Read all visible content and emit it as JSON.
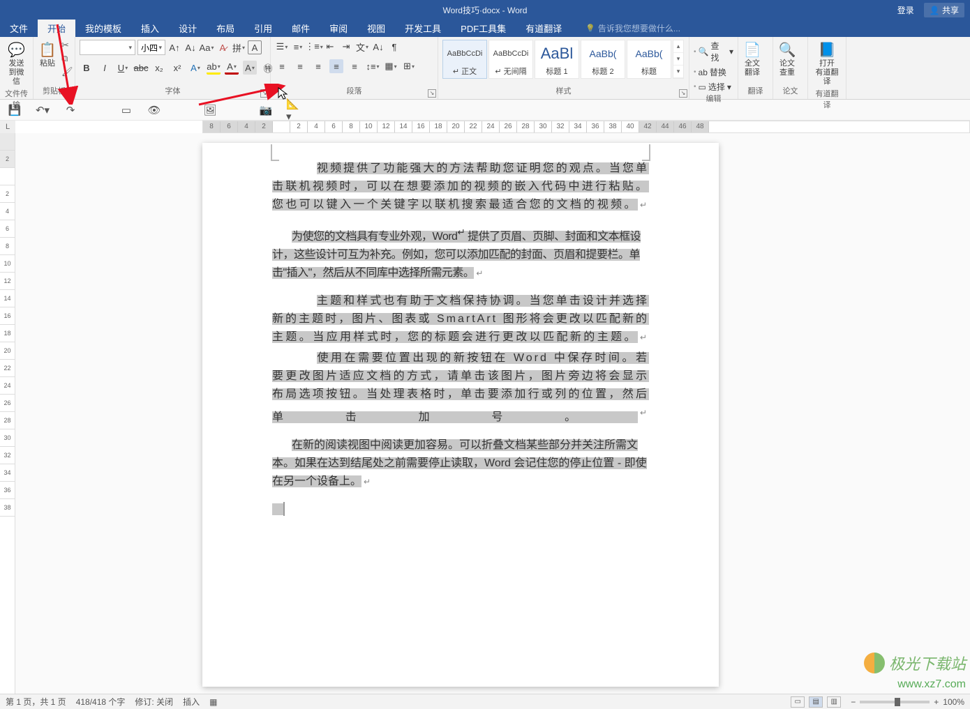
{
  "titlebar": {
    "title": "Word技巧·docx - Word",
    "login": "登录",
    "share": "共享"
  },
  "tabs": {
    "file": "文件",
    "home": "开始",
    "mytpl": "我的模板",
    "insert": "插入",
    "design": "设计",
    "layout": "布局",
    "ref": "引用",
    "mail": "邮件",
    "review": "审阅",
    "view": "视图",
    "dev": "开发工具",
    "pdf": "PDF工具集",
    "yd": "有道翻译",
    "tell": "告诉我您想要做什么..."
  },
  "groups": {
    "wechat": "文件传输",
    "clipboard": "剪贴板",
    "font": "字体",
    "para": "段落",
    "styles": "样式",
    "edit": "编辑",
    "trans": "翻译",
    "find": "论文",
    "yd": "有道翻译"
  },
  "wechat": {
    "line1": "发送",
    "line2": "到微信"
  },
  "clip": {
    "paste": "粘贴"
  },
  "font": {
    "name": "",
    "size": "小四"
  },
  "styles": {
    "s1": {
      "prev": "AaBbCcDi",
      "name": "↵ 正文"
    },
    "s2": {
      "prev": "AaBbCcDi",
      "name": "↵ 无间隔"
    },
    "s3": {
      "prev": "AaBl",
      "name": "标题 1"
    },
    "s4": {
      "prev": "AaBb(",
      "name": "标题 2"
    },
    "s5": {
      "prev": "AaBb(",
      "name": "标题"
    }
  },
  "edit": {
    "find": "查找",
    "replace": "替换",
    "select": "选择"
  },
  "trans": {
    "l1": "全文",
    "l2": "翻译"
  },
  "findg": {
    "l1": "论文",
    "l2": "查重"
  },
  "ydg": {
    "l1": "打开",
    "l2": "有道翻译"
  },
  "ruler_nums": [
    "8",
    "6",
    "4",
    "2",
    "",
    "2",
    "4",
    "6",
    "8",
    "10",
    "12",
    "14",
    "16",
    "18",
    "20",
    "22",
    "24",
    "26",
    "28",
    "30",
    "32",
    "34",
    "36",
    "38",
    "40",
    "42",
    "44",
    "46",
    "48"
  ],
  "vruler": [
    "",
    "2",
    "",
    "2",
    "4",
    "6",
    "8",
    "10",
    "12",
    "14",
    "16",
    "18",
    "20",
    "22",
    "24",
    "26",
    "28",
    "30",
    "32",
    "34",
    "36",
    "38"
  ],
  "doc": {
    "p1": "视频提供了功能强大的方法帮助您证明您的观点。当您单击联机视频时，可以在想要添加的视频的嵌入代码中进行粘贴。您也可以键入一个关键字以联机搜索最适合您的文档的视频。",
    "p2a": "为使您的文档具有专业外观，Word",
    "p2b": " 提供了页眉、页脚、封面和文本框设计，这些设计可互为补充。例如，您可以添加匹配的封面、页眉和提要栏。单击\"插入\"，然后从不同库中选择所需元素。",
    "p3a": "主题和样式也有助于文档保持协调。当您单击设计并选择新的主题时，图片、图表或 SmartArt 图形将会更改以匹配新的主题。当应用样式时，您的标题会进行更改以匹配新的主题。",
    "p3b": "使用在需要位置出现的新按钮在 Word 中保存时间。若要更改图片适应文档的方式，请单击该图片，图片旁边将会显示布局选项按钮。当处理表格时，单击要添加行或列的位置，然后单击加号。",
    "p4a": "在新的阅读视图中阅读更加容易。可以折叠文档某些部分并关注所需文本。如果在达到结尾处之前需要停止读取，Word 会记住您的停止位置 - 即使在另一个设备上。"
  },
  "status": {
    "page": "第 1 页，共 1 页",
    "words": "418/418 个字",
    "track": "修订: 关闭",
    "insert": "插入",
    "zoom": "100%"
  },
  "watermark": {
    "w1": "极光下载站",
    "w2": "www.xz7.com"
  }
}
